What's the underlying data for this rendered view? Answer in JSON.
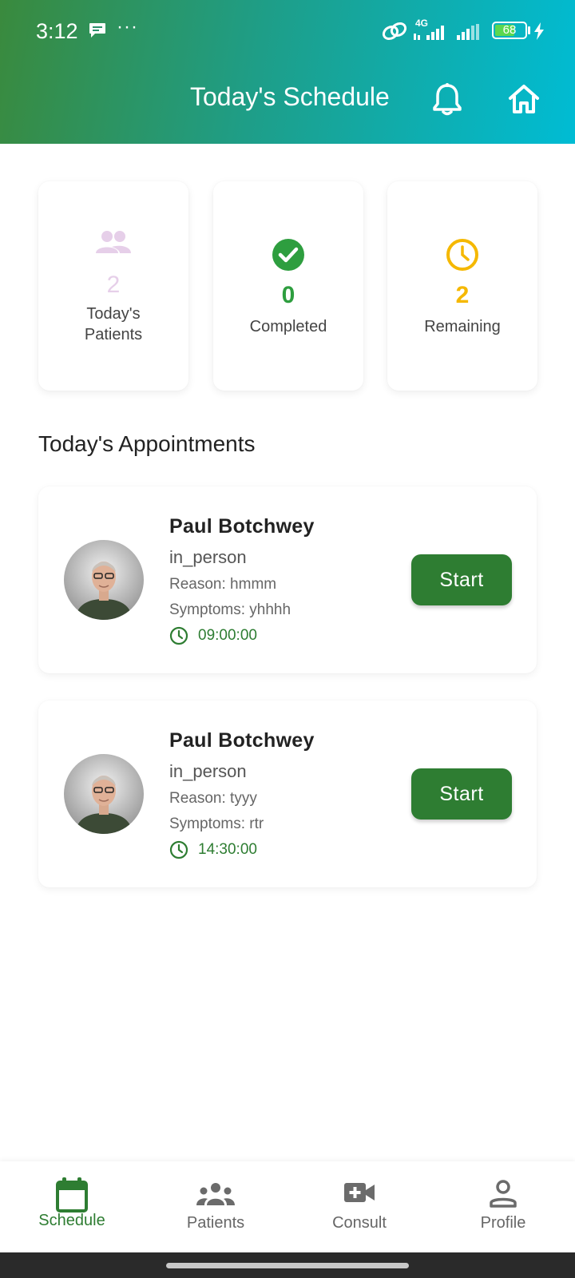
{
  "status_bar": {
    "time": "3:12",
    "dots": "···",
    "network": "4G",
    "battery": "68",
    "battery_level": 0.68
  },
  "header": {
    "title": "Today's Schedule",
    "notification_icon": "bell-icon",
    "home_icon": "home-icon"
  },
  "stats": [
    {
      "icon": "people-icon",
      "value": "2",
      "label": "Today's Patients",
      "color": "#e6cfe9"
    },
    {
      "icon": "check-circle-icon",
      "value": "0",
      "label": "Completed",
      "color": "#2e9e3f"
    },
    {
      "icon": "clock-icon",
      "value": "2",
      "label": "Remaining",
      "color": "#f5b800"
    }
  ],
  "appointments_title": "Today's Appointments",
  "appointments": [
    {
      "name": "Paul Botchwey",
      "type": "in_person",
      "reason": "Reason: hmmm",
      "symptoms": "Symptoms: yhhhh",
      "time": "09:00:00",
      "button": "Start"
    },
    {
      "name": "Paul Botchwey",
      "type": "in_person",
      "reason": "Reason: tyyy",
      "symptoms": "Symptoms: rtr",
      "time": "14:30:00",
      "button": "Start"
    }
  ],
  "nav": [
    {
      "label": "Schedule",
      "icon": "calendar-icon",
      "active": true
    },
    {
      "label": "Patients",
      "icon": "groups-icon",
      "active": false
    },
    {
      "label": "Consult",
      "icon": "video-plus-icon",
      "active": false
    },
    {
      "label": "Profile",
      "icon": "person-icon",
      "active": false
    }
  ],
  "colors": {
    "primary": "#2e7d32",
    "header_start": "#3a8a3d",
    "header_end": "#00bcd4",
    "muted_text": "#666666"
  }
}
